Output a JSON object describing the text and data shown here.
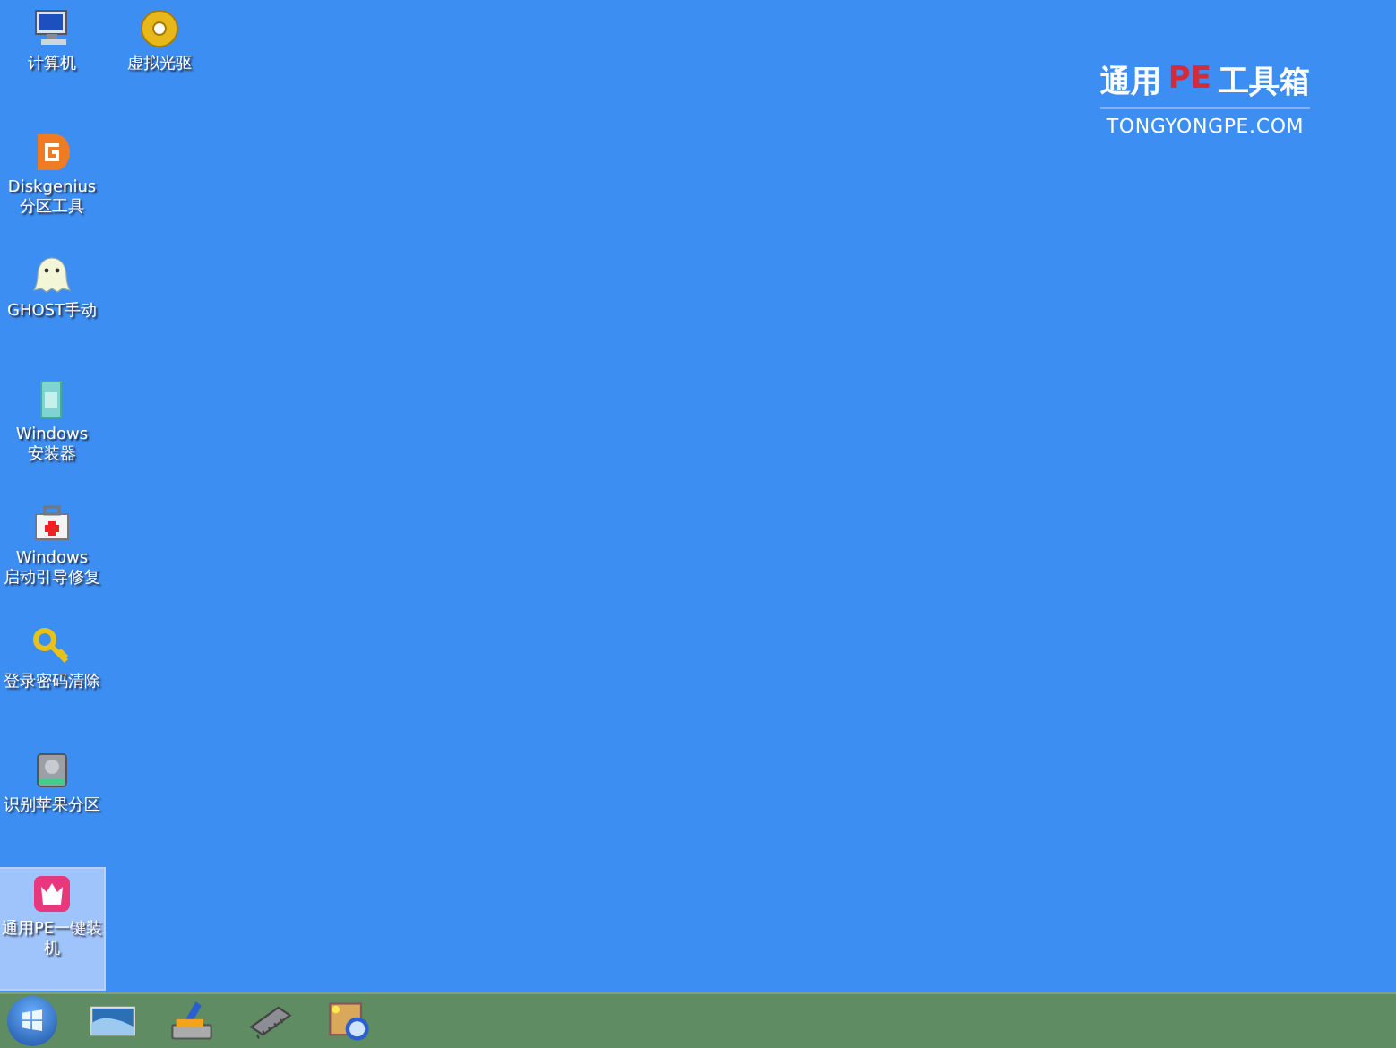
{
  "desktop_icons": [
    {
      "label": "计算机",
      "kind": "computer",
      "selected": false
    },
    {
      "label": "虚拟光驱",
      "kind": "disc",
      "selected": false
    },
    {
      "label": "Diskgenius\n分区工具",
      "kind": "diskgenius",
      "selected": false
    },
    {
      "label": "GHOST手动",
      "kind": "ghost",
      "selected": false
    },
    {
      "label": "Windows\n安装器",
      "kind": "installer",
      "selected": false
    },
    {
      "label": "Windows\n启动引导修复",
      "kind": "firstaid",
      "selected": false
    },
    {
      "label": "登录密码清除",
      "kind": "key",
      "selected": false
    },
    {
      "label": "识别苹果分区",
      "kind": "drive",
      "selected": false
    },
    {
      "label": "通用PE一键装机",
      "kind": "pink",
      "selected": true
    }
  ],
  "logo": {
    "title_left": "通用",
    "title_highlight": "PE",
    "title_right": "工具箱",
    "url": "TONGYONGPE.COM"
  },
  "taskbar": {
    "items": [
      {
        "kind": "monitor"
      },
      {
        "kind": "cleaner"
      },
      {
        "kind": "chip"
      },
      {
        "kind": "tool"
      }
    ]
  }
}
